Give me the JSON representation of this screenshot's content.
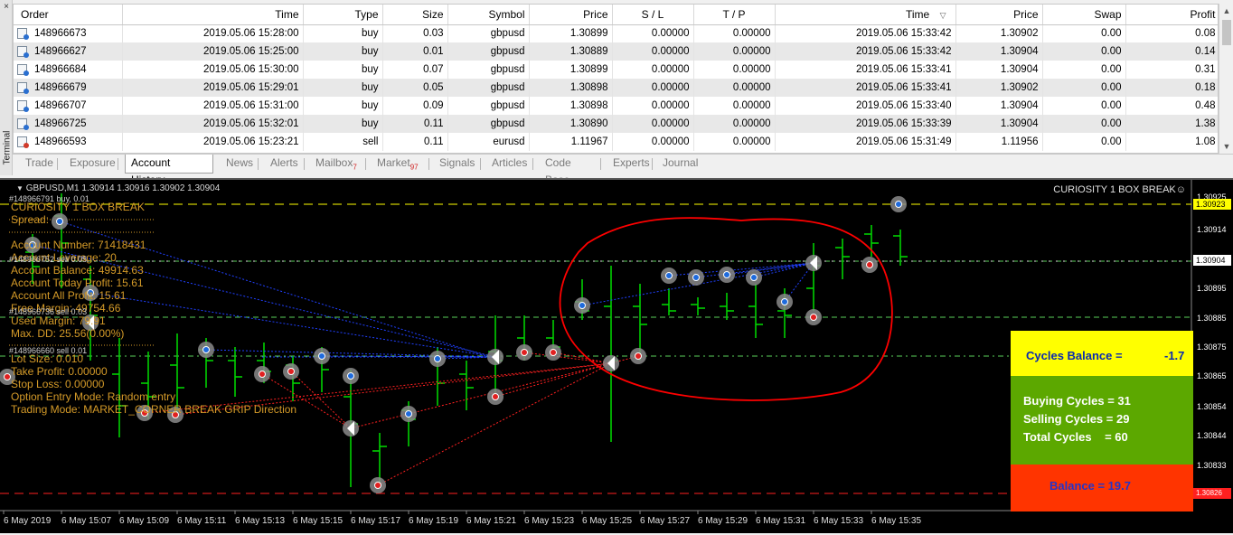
{
  "terminal": {
    "side_label": "Terminal",
    "close_glyph": "×",
    "columns": [
      "Order",
      "Time",
      "Type",
      "Size",
      "Symbol",
      "Price",
      "S / L",
      "T / P",
      "Time",
      "Price",
      "Swap",
      "Profit"
    ],
    "sort_indicator": "▽",
    "rows": [
      {
        "order": "148966673",
        "open_time": "2019.05.06 15:28:00",
        "type": "buy",
        "size": "0.03",
        "symbol": "gbpusd",
        "price": "1.30899",
        "sl": "0.00000",
        "tp": "0.00000",
        "close_time": "2019.05.06 15:33:42",
        "close_price": "1.30902",
        "swap": "0.00",
        "profit": "0.08"
      },
      {
        "order": "148966627",
        "open_time": "2019.05.06 15:25:00",
        "type": "buy",
        "size": "0.01",
        "symbol": "gbpusd",
        "price": "1.30889",
        "sl": "0.00000",
        "tp": "0.00000",
        "close_time": "2019.05.06 15:33:42",
        "close_price": "1.30904",
        "swap": "0.00",
        "profit": "0.14"
      },
      {
        "order": "148966684",
        "open_time": "2019.05.06 15:30:00",
        "type": "buy",
        "size": "0.07",
        "symbol": "gbpusd",
        "price": "1.30899",
        "sl": "0.00000",
        "tp": "0.00000",
        "close_time": "2019.05.06 15:33:41",
        "close_price": "1.30904",
        "swap": "0.00",
        "profit": "0.31"
      },
      {
        "order": "148966679",
        "open_time": "2019.05.06 15:29:01",
        "type": "buy",
        "size": "0.05",
        "symbol": "gbpusd",
        "price": "1.30898",
        "sl": "0.00000",
        "tp": "0.00000",
        "close_time": "2019.05.06 15:33:41",
        "close_price": "1.30902",
        "swap": "0.00",
        "profit": "0.18"
      },
      {
        "order": "148966707",
        "open_time": "2019.05.06 15:31:00",
        "type": "buy",
        "size": "0.09",
        "symbol": "gbpusd",
        "price": "1.30898",
        "sl": "0.00000",
        "tp": "0.00000",
        "close_time": "2019.05.06 15:33:40",
        "close_price": "1.30904",
        "swap": "0.00",
        "profit": "0.48"
      },
      {
        "order": "148966725",
        "open_time": "2019.05.06 15:32:01",
        "type": "buy",
        "size": "0.11",
        "symbol": "gbpusd",
        "price": "1.30890",
        "sl": "0.00000",
        "tp": "0.00000",
        "close_time": "2019.05.06 15:33:39",
        "close_price": "1.30904",
        "swap": "0.00",
        "profit": "1.38"
      },
      {
        "order": "148966593",
        "open_time": "2019.05.06 15:23:21",
        "type": "sell",
        "size": "0.11",
        "symbol": "eurusd",
        "price": "1.11967",
        "sl": "0.00000",
        "tp": "0.00000",
        "close_time": "2019.05.06 15:31:49",
        "close_price": "1.11956",
        "swap": "0.00",
        "profit": "1.08"
      }
    ],
    "tabs": [
      {
        "label": "Trade",
        "badge": ""
      },
      {
        "label": "Exposure",
        "badge": ""
      },
      {
        "label": "Account History",
        "badge": "",
        "active": true
      },
      {
        "label": "News",
        "badge": ""
      },
      {
        "label": "Alerts",
        "badge": ""
      },
      {
        "label": "Mailbox",
        "badge": "7"
      },
      {
        "label": "Market",
        "badge": "97"
      },
      {
        "label": "Signals",
        "badge": ""
      },
      {
        "label": "Articles",
        "badge": ""
      },
      {
        "label": "Code Base",
        "badge": ""
      },
      {
        "label": "Experts",
        "badge": ""
      },
      {
        "label": "Journal",
        "badge": ""
      }
    ]
  },
  "chart": {
    "symbol_header": "GBPUSD,M1  1.30914 1.30916 1.30902 1.30904",
    "ea_name": "CURIOSITY 1 BOX BREAK",
    "ea_smiley": "☺",
    "colors": {
      "bull": "#00d000",
      "bear": "#00d000",
      "ea_text": "#d49a28",
      "ask_line": "#ffff00",
      "bid_line": "#e0e0e0",
      "trend_blue": "#2040ff",
      "trend_red": "#ff2020",
      "circle": "#ff0000"
    },
    "ea_panel": {
      "title": "CURIOSITY 1 BOX BREAK",
      "spread": "Spread:",
      "account_number": "Account Number: 71418431",
      "account_leverage": "Account Leverage: 20",
      "account_balance": "Account Balance: 49914.63",
      "account_today_profit": "Account Today Profit: 15.61",
      "account_all_profit": "Account All Profit: 15.61",
      "free_margin": "Free Margin: 49754.66",
      "used_margin": "Used Margin: 79.91",
      "max_dd": "Max. DD: 25.56(0.00%)",
      "lot_size": "Lot Size: 0.010",
      "take_profit": "Take Profit: 0.00000",
      "stop_loss": "Stop Loss: 0.00000",
      "option_entry": "Option Entry Mode:  Random entry",
      "trading_mode": "Trading Mode: MARKET_CORNER BREAK GRIP Direction"
    },
    "order_labels": [
      "#148966791 buy, 0.01",
      "#148966752 sell 0.05",
      "#148966736 sell 0.03",
      "#148966660 sell 0.01"
    ],
    "price_axis": [
      "1.30925",
      "1.30923",
      "1.30914",
      "1.30904",
      "1.30895",
      "1.30885",
      "1.30875",
      "1.30865",
      "1.30854",
      "1.30844",
      "1.30833",
      "1.30826"
    ],
    "time_axis": [
      "6 May 2019",
      "6 May 15:07",
      "6 May 15:09",
      "6 May 15:11",
      "6 May 15:13",
      "6 May 15:15",
      "6 May 15:17",
      "6 May 15:19",
      "6 May 15:21",
      "6 May 15:23",
      "6 May 15:25",
      "6 May 15:27",
      "6 May 15:29",
      "6 May 15:31",
      "6 May 15:33",
      "6 May 15:35"
    ],
    "stats": {
      "cycles_balance_label": "Cycles Balance =",
      "cycles_balance_value": "-1.7",
      "buying_cycles": "Buying Cycles = 31",
      "selling_cycles": "Selling Cycles = 29",
      "total_cycles": "Total Cycles    = 60",
      "balance": "Balance = 19.7"
    }
  }
}
